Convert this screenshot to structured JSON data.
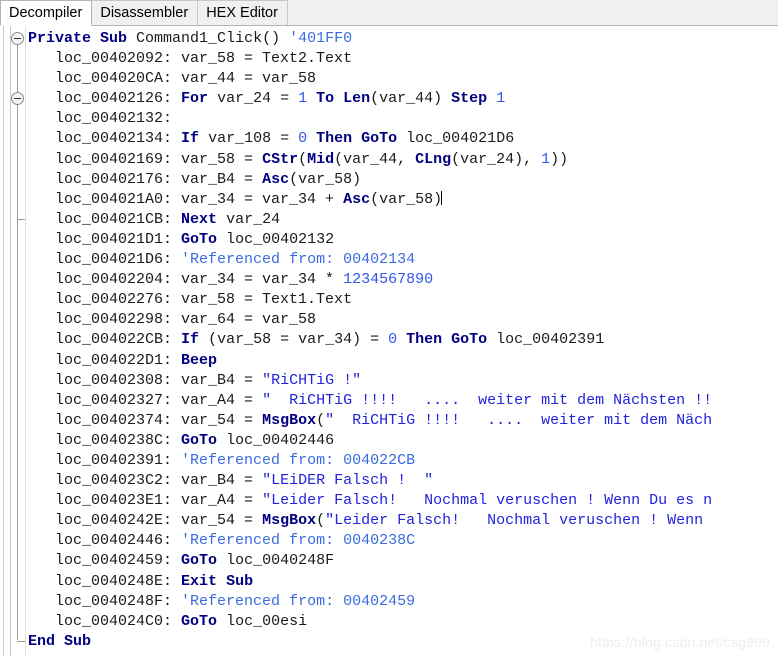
{
  "window": {
    "title": "Decompiler"
  },
  "tabs": [
    {
      "label": "Decompiler",
      "active": true
    },
    {
      "label": "Disassembler",
      "active": false
    },
    {
      "label": "HEX Editor",
      "active": false
    }
  ],
  "gutter": {
    "fold_markers": [
      {
        "name": "fold-toggle-sub",
        "state": "expanded"
      },
      {
        "name": "fold-toggle-for",
        "state": "expanded"
      }
    ]
  },
  "code": {
    "language": "Visual Basic (decompiled)",
    "lines": [
      {
        "indent": 0,
        "tokens": [
          {
            "t": "Private",
            "c": "kw"
          },
          {
            "t": " ",
            "c": "pln"
          },
          {
            "t": "Sub",
            "c": "kw"
          },
          {
            "t": " Command1_Click() ",
            "c": "pln"
          },
          {
            "t": "'401FF0",
            "c": "cmt"
          }
        ]
      },
      {
        "indent": 1,
        "tokens": [
          {
            "t": "loc_00402092: var_58 = Text2.Text",
            "c": "pln"
          }
        ]
      },
      {
        "indent": 1,
        "tokens": [
          {
            "t": "loc_004020CA: var_44 = var_58",
            "c": "pln"
          }
        ]
      },
      {
        "indent": 1,
        "tokens": [
          {
            "t": "loc_00402126: ",
            "c": "pln"
          },
          {
            "t": "For",
            "c": "kw"
          },
          {
            "t": " var_24 = ",
            "c": "pln"
          },
          {
            "t": "1",
            "c": "num"
          },
          {
            "t": " ",
            "c": "pln"
          },
          {
            "t": "To",
            "c": "kw"
          },
          {
            "t": " ",
            "c": "pln"
          },
          {
            "t": "Len",
            "c": "kw"
          },
          {
            "t": "(var_44) ",
            "c": "pln"
          },
          {
            "t": "Step",
            "c": "kw"
          },
          {
            "t": " ",
            "c": "pln"
          },
          {
            "t": "1",
            "c": "num"
          }
        ]
      },
      {
        "indent": 1,
        "tokens": [
          {
            "t": "loc_00402132:",
            "c": "pln"
          }
        ]
      },
      {
        "indent": 1,
        "tokens": [
          {
            "t": "loc_00402134: ",
            "c": "pln"
          },
          {
            "t": "If",
            "c": "kw"
          },
          {
            "t": " var_108 = ",
            "c": "pln"
          },
          {
            "t": "0",
            "c": "num"
          },
          {
            "t": " ",
            "c": "pln"
          },
          {
            "t": "Then",
            "c": "kw"
          },
          {
            "t": " ",
            "c": "pln"
          },
          {
            "t": "GoTo",
            "c": "kw"
          },
          {
            "t": " loc_004021D6",
            "c": "pln"
          }
        ]
      },
      {
        "indent": 1,
        "tokens": [
          {
            "t": "loc_00402169: var_58 = ",
            "c": "pln"
          },
          {
            "t": "CStr",
            "c": "kw"
          },
          {
            "t": "(",
            "c": "pln"
          },
          {
            "t": "Mid",
            "c": "kw"
          },
          {
            "t": "(var_44, ",
            "c": "pln"
          },
          {
            "t": "CLng",
            "c": "kw"
          },
          {
            "t": "(var_24), ",
            "c": "pln"
          },
          {
            "t": "1",
            "c": "num"
          },
          {
            "t": "))",
            "c": "pln"
          }
        ]
      },
      {
        "indent": 1,
        "tokens": [
          {
            "t": "loc_00402176: var_B4 = ",
            "c": "pln"
          },
          {
            "t": "Asc",
            "c": "kw"
          },
          {
            "t": "(var_58)",
            "c": "pln"
          }
        ]
      },
      {
        "indent": 1,
        "caret": true,
        "tokens": [
          {
            "t": "loc_004021A0: var_34 = var_34 + ",
            "c": "pln"
          },
          {
            "t": "Asc",
            "c": "kw"
          },
          {
            "t": "(var_58)",
            "c": "pln"
          }
        ]
      },
      {
        "indent": 1,
        "tokens": [
          {
            "t": "loc_004021CB: ",
            "c": "pln"
          },
          {
            "t": "Next",
            "c": "kw"
          },
          {
            "t": " var_24",
            "c": "pln"
          }
        ]
      },
      {
        "indent": 1,
        "tokens": [
          {
            "t": "loc_004021D1: ",
            "c": "pln"
          },
          {
            "t": "GoTo",
            "c": "kw"
          },
          {
            "t": " loc_00402132",
            "c": "pln"
          }
        ]
      },
      {
        "indent": 1,
        "tokens": [
          {
            "t": "loc_004021D6: ",
            "c": "pln"
          },
          {
            "t": "'Referenced from: 00402134",
            "c": "cmt"
          }
        ]
      },
      {
        "indent": 1,
        "tokens": [
          {
            "t": "loc_00402204: var_34 = var_34 * ",
            "c": "pln"
          },
          {
            "t": "1234567890",
            "c": "num"
          }
        ]
      },
      {
        "indent": 1,
        "tokens": [
          {
            "t": "loc_00402276: var_58 = Text1.Text",
            "c": "pln"
          }
        ]
      },
      {
        "indent": 1,
        "tokens": [
          {
            "t": "loc_00402298: var_64 = var_58",
            "c": "pln"
          }
        ]
      },
      {
        "indent": 1,
        "tokens": [
          {
            "t": "loc_004022CB: ",
            "c": "pln"
          },
          {
            "t": "If",
            "c": "kw"
          },
          {
            "t": " (var_58 = var_34) = ",
            "c": "pln"
          },
          {
            "t": "0",
            "c": "num"
          },
          {
            "t": " ",
            "c": "pln"
          },
          {
            "t": "Then",
            "c": "kw"
          },
          {
            "t": " ",
            "c": "pln"
          },
          {
            "t": "GoTo",
            "c": "kw"
          },
          {
            "t": " loc_00402391",
            "c": "pln"
          }
        ]
      },
      {
        "indent": 1,
        "tokens": [
          {
            "t": "loc_004022D1: ",
            "c": "pln"
          },
          {
            "t": "Beep",
            "c": "kw"
          }
        ]
      },
      {
        "indent": 1,
        "tokens": [
          {
            "t": "loc_00402308: var_B4 = ",
            "c": "pln"
          },
          {
            "t": "\"RiCHTiG !\"",
            "c": "str"
          }
        ]
      },
      {
        "indent": 1,
        "tokens": [
          {
            "t": "loc_00402327: var_A4 = ",
            "c": "pln"
          },
          {
            "t": "\"  RiCHTiG !!!!   ....  weiter mit dem Nächsten !!",
            "c": "str"
          }
        ]
      },
      {
        "indent": 1,
        "tokens": [
          {
            "t": "loc_00402374: var_54 = ",
            "c": "pln"
          },
          {
            "t": "MsgBox",
            "c": "kw"
          },
          {
            "t": "(",
            "c": "pln"
          },
          {
            "t": "\"  RiCHTiG !!!!   ....  weiter mit dem Näch",
            "c": "str"
          }
        ]
      },
      {
        "indent": 1,
        "tokens": [
          {
            "t": "loc_0040238C: ",
            "c": "pln"
          },
          {
            "t": "GoTo",
            "c": "kw"
          },
          {
            "t": " loc_00402446",
            "c": "pln"
          }
        ]
      },
      {
        "indent": 1,
        "tokens": [
          {
            "t": "loc_00402391: ",
            "c": "pln"
          },
          {
            "t": "'Referenced from: 004022CB",
            "c": "cmt"
          }
        ]
      },
      {
        "indent": 1,
        "tokens": [
          {
            "t": "loc_004023C2: var_B4 = ",
            "c": "pln"
          },
          {
            "t": "\"LEiDER Falsch !  \"",
            "c": "str"
          }
        ]
      },
      {
        "indent": 1,
        "tokens": [
          {
            "t": "loc_004023E1: var_A4 = ",
            "c": "pln"
          },
          {
            "t": "\"Leider Falsch!   Nochmal veruschen ! Wenn Du es n",
            "c": "str"
          }
        ]
      },
      {
        "indent": 1,
        "tokens": [
          {
            "t": "loc_0040242E: var_54 = ",
            "c": "pln"
          },
          {
            "t": "MsgBox",
            "c": "kw"
          },
          {
            "t": "(",
            "c": "pln"
          },
          {
            "t": "\"Leider Falsch!   Nochmal veruschen ! Wenn",
            "c": "str"
          }
        ]
      },
      {
        "indent": 1,
        "tokens": [
          {
            "t": "loc_00402446: ",
            "c": "pln"
          },
          {
            "t": "'Referenced from: 0040238C",
            "c": "cmt"
          }
        ]
      },
      {
        "indent": 1,
        "tokens": [
          {
            "t": "loc_00402459: ",
            "c": "pln"
          },
          {
            "t": "GoTo",
            "c": "kw"
          },
          {
            "t": " loc_0040248F",
            "c": "pln"
          }
        ]
      },
      {
        "indent": 1,
        "tokens": [
          {
            "t": "loc_0040248E: ",
            "c": "pln"
          },
          {
            "t": "Exit",
            "c": "kw"
          },
          {
            "t": " ",
            "c": "pln"
          },
          {
            "t": "Sub",
            "c": "kw"
          }
        ]
      },
      {
        "indent": 1,
        "tokens": [
          {
            "t": "loc_0040248F: ",
            "c": "pln"
          },
          {
            "t": "'Referenced from: 00402459",
            "c": "cmt"
          }
        ]
      },
      {
        "indent": 1,
        "tokens": [
          {
            "t": "loc_004024C0: ",
            "c": "pln"
          },
          {
            "t": "GoTo",
            "c": "kw"
          },
          {
            "t": " loc_00esi",
            "c": "pln"
          }
        ]
      },
      {
        "indent": 0,
        "tokens": [
          {
            "t": "End",
            "c": "kw"
          },
          {
            "t": " ",
            "c": "pln"
          },
          {
            "t": "Sub",
            "c": "kw"
          }
        ]
      }
    ]
  },
  "watermark": {
    "text": "https://blog.csdn.net/csg999"
  },
  "colors": {
    "keyword": "#000080",
    "string": "#2222dd",
    "comment": "#3b6be0",
    "number": "#3355ee",
    "plain": "#1b1b1b",
    "tabbar_bg": "#f0f0f0",
    "editor_bg": "#ffffff"
  }
}
